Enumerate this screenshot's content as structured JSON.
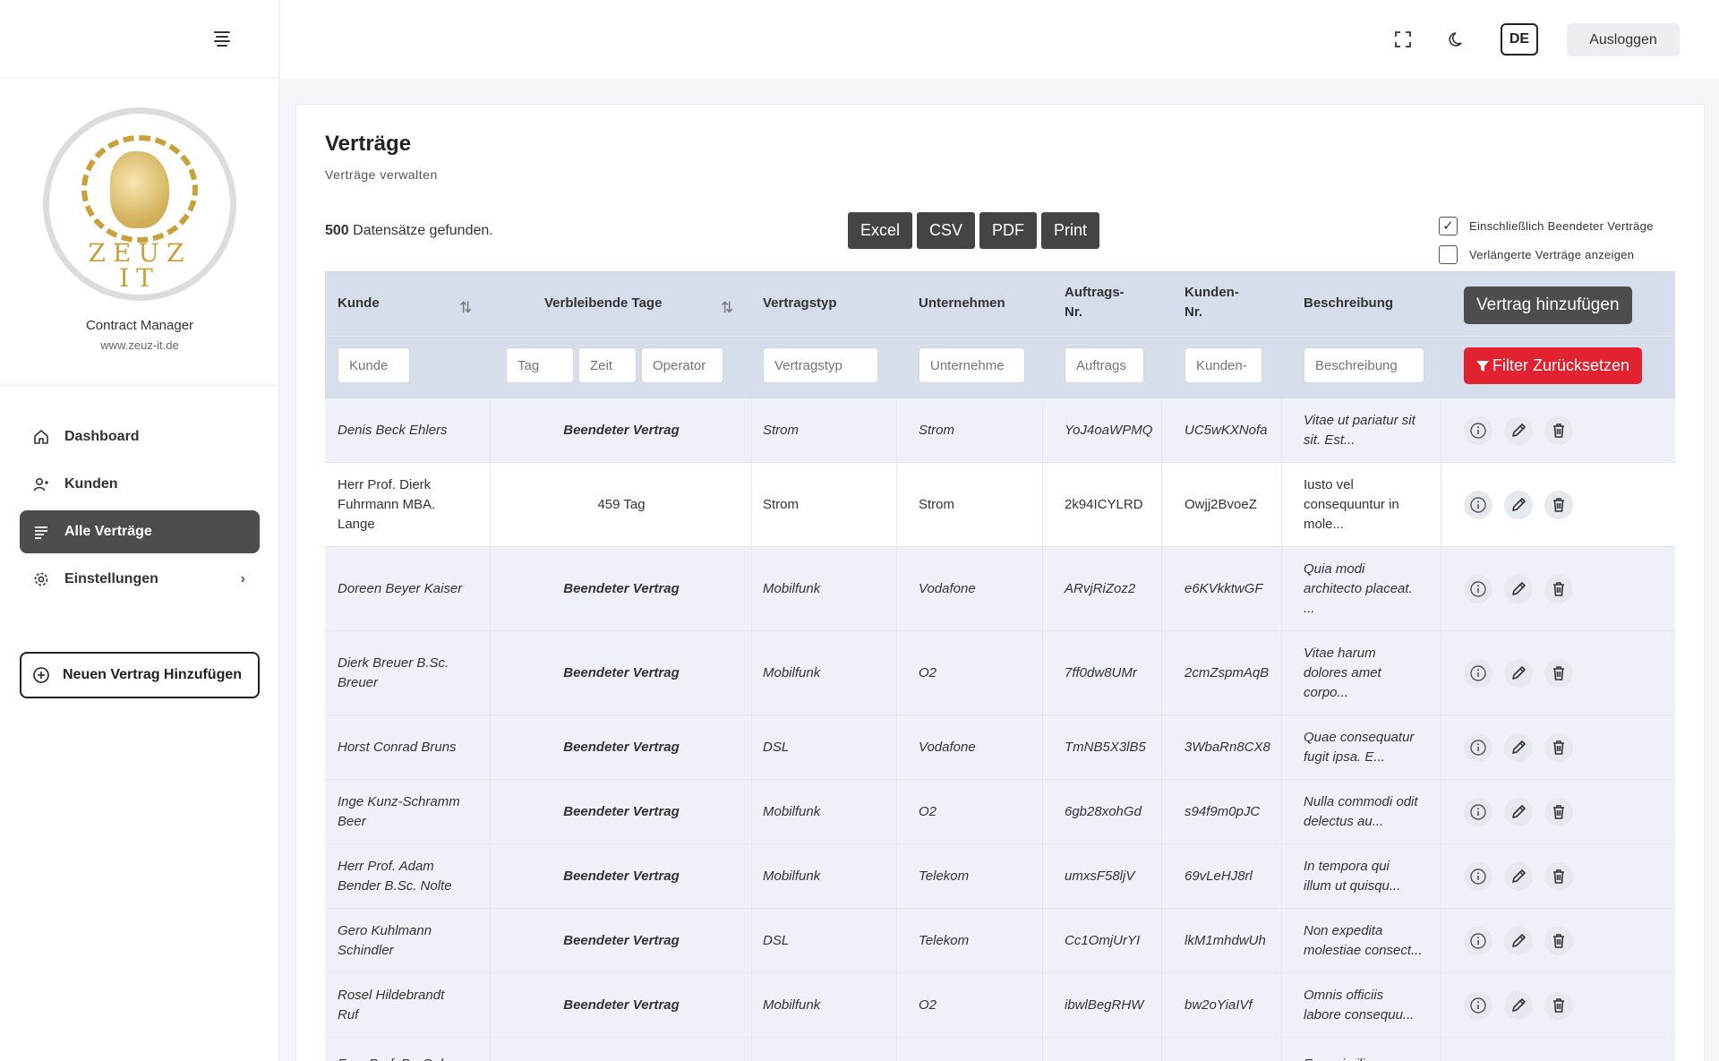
{
  "sidebar": {
    "logo_text_1": "ZEUZ",
    "logo_text_2": "IT",
    "app_name": "Contract Manager",
    "app_url": "www.zeuz-it.de",
    "items": [
      {
        "label": "Dashboard",
        "icon": "home-icon"
      },
      {
        "label": "Kunden",
        "icon": "user-icon"
      },
      {
        "label": "Alle Verträge",
        "icon": "list-icon"
      },
      {
        "label": "Einstellungen",
        "icon": "gear-icon"
      }
    ],
    "new_button": "Neuen Vertrag Hinzufügen"
  },
  "topbar": {
    "language": "DE",
    "logout": "Ausloggen"
  },
  "page": {
    "title": "Verträge",
    "subtitle": "Verträge verwalten",
    "record_count": "500",
    "record_suffix": "Datensätze gefunden.",
    "exports": [
      "Excel",
      "CSV",
      "PDF",
      "Print"
    ],
    "check_include_ended": "Einschließlich Beendeter Verträge",
    "check_extended": "Verlängerte Verträge anzeigen",
    "add_button": "Vertrag hinzufügen",
    "reset_button": "Filter Zurücksetzen"
  },
  "table": {
    "headers": {
      "kunde": "Kunde",
      "tage": "Verbleibende Tage",
      "typ": "Vertragstyp",
      "unternehmen": "Unternehmen",
      "auftrag_1": "Auftrags-",
      "auftrag_2": "Nr.",
      "kundennr_1": "Kunden-",
      "kundennr_2": "Nr.",
      "beschreibung": "Beschreibung"
    },
    "filters": {
      "kunde": "Kunde",
      "tag": "Tag",
      "zeit": "Zeit",
      "operator": "Operator",
      "typ": "Vertragstyp",
      "unternehmen": "Unternehme",
      "auftrag": "Auftrags",
      "kundennr": "Kunden-",
      "beschreibung": "Beschreibung"
    },
    "rows": [
      {
        "kunde": [
          "Denis Beck Ehlers"
        ],
        "tage": "Beendeter Vertrag",
        "typ": "Strom",
        "unternehmen": "Strom",
        "auftrag": "YoJ4oaWPMQ",
        "kundennr": "UC5wKXNofa",
        "beschreibung": [
          "Vitae ut pariatur sit",
          "sit. Est..."
        ],
        "ended": true
      },
      {
        "kunde": [
          "Herr Prof. Dierk",
          "Fuhrmann MBA.",
          "Lange"
        ],
        "tage": "459 Tag",
        "typ": "Strom",
        "unternehmen": "Strom",
        "auftrag": "2k94ICYLRD",
        "kundennr": "Owjj2BvoeZ",
        "beschreibung": [
          "Iusto vel",
          "consequuntur in",
          "mole..."
        ],
        "ended": false
      },
      {
        "kunde": [
          "Doreen Beyer Kaiser"
        ],
        "tage": "Beendeter Vertrag",
        "typ": "Mobilfunk",
        "unternehmen": "Vodafone",
        "auftrag": "ARvjRiZoz2",
        "kundennr": "e6KVkktwGF",
        "beschreibung": [
          "Quia modi",
          "architecto placeat.",
          "..."
        ],
        "ended": true
      },
      {
        "kunde": [
          "Dierk Breuer B.Sc.",
          "Breuer"
        ],
        "tage": "Beendeter Vertrag",
        "typ": "Mobilfunk",
        "unternehmen": "O2",
        "auftrag": "7ff0dw8UMr",
        "kundennr": "2cmZspmAqB",
        "beschreibung": [
          "Vitae harum",
          "dolores amet",
          "corpo..."
        ],
        "ended": true
      },
      {
        "kunde": [
          "Horst Conrad Bruns"
        ],
        "tage": "Beendeter Vertrag",
        "typ": "DSL",
        "unternehmen": "Vodafone",
        "auftrag": "TmNB5X3lB5",
        "kundennr": "3WbaRn8CX8",
        "beschreibung": [
          "Quae consequatur",
          "fugit ipsa. E..."
        ],
        "ended": true
      },
      {
        "kunde": [
          "Inge Kunz-Schramm",
          "Beer"
        ],
        "tage": "Beendeter Vertrag",
        "typ": "Mobilfunk",
        "unternehmen": "O2",
        "auftrag": "6gb28xohGd",
        "kundennr": "s94f9m0pJC",
        "beschreibung": [
          "Nulla commodi odit",
          "delectus au..."
        ],
        "ended": true
      },
      {
        "kunde": [
          "Herr Prof. Adam",
          "Bender B.Sc. Nolte"
        ],
        "tage": "Beendeter Vertrag",
        "typ": "Mobilfunk",
        "unternehmen": "Telekom",
        "auftrag": "umxsF58ljV",
        "kundennr": "69vLeHJ8rl",
        "beschreibung": [
          "In tempora qui",
          "illum ut quisqu..."
        ],
        "ended": true
      },
      {
        "kunde": [
          "Gero Kuhlmann",
          "Schindler"
        ],
        "tage": "Beendeter Vertrag",
        "typ": "DSL",
        "unternehmen": "Telekom",
        "auftrag": "Cc1OmjUrYI",
        "kundennr": "lkM1mhdwUh",
        "beschreibung": [
          "Non expedita",
          "molestiae consect..."
        ],
        "ended": true
      },
      {
        "kunde": [
          "Rosel Hildebrandt",
          "Ruf"
        ],
        "tage": "Beendeter Vertrag",
        "typ": "Mobilfunk",
        "unternehmen": "O2",
        "auftrag": "ibwlBegRHW",
        "kundennr": "bw2oYiaIVf",
        "beschreibung": [
          "Omnis officiis",
          "labore consequu..."
        ],
        "ended": true
      },
      {
        "kunde": [
          "Frau Prof. Dr. Gaby"
        ],
        "tage": "",
        "typ": "",
        "unternehmen": "",
        "auftrag": "",
        "kundennr": "",
        "beschreibung": [
          "Eum similique"
        ],
        "ended": true
      }
    ]
  }
}
